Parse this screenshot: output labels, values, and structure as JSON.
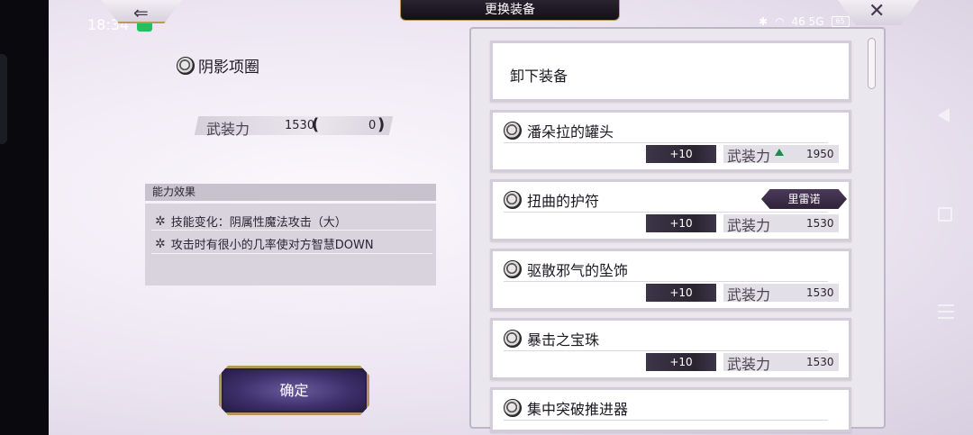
{
  "status_bar": {
    "time": "18:34",
    "network": "46 5G",
    "battery": "65"
  },
  "header": {
    "title": "更换装备",
    "back_icon": "back-arrow-icon",
    "close_icon": "close-icon"
  },
  "selected_item": {
    "name": "阴影项圈",
    "power_label": "武装力",
    "power_value": "1530",
    "power_diff": "0",
    "ability_header": "能力效果",
    "abilities": [
      "技能变化：阴属性魔法攻击（大）",
      "攻击时有很小的几率使对方智慧DOWN"
    ]
  },
  "confirm_label": "确定",
  "equip_list": {
    "unequip_label": "卸下装备",
    "items": [
      {
        "name": "潘朵拉的罐头",
        "plus": "+10",
        "stat_label": "武装力",
        "stat_value": "1950",
        "stat_up": true,
        "owner": ""
      },
      {
        "name": "扭曲的护符",
        "plus": "+10",
        "stat_label": "武装力",
        "stat_value": "1530",
        "stat_up": false,
        "owner": "里雷诺"
      },
      {
        "name": "驱散邪气的坠饰",
        "plus": "+10",
        "stat_label": "武装力",
        "stat_value": "1530",
        "stat_up": false,
        "owner": ""
      },
      {
        "name": "暴击之宝珠",
        "plus": "+10",
        "stat_label": "武装力",
        "stat_value": "1530",
        "stat_up": false,
        "owner": ""
      },
      {
        "name": "集中突破推进器",
        "plus": "",
        "stat_label": "",
        "stat_value": "",
        "stat_up": false,
        "owner": ""
      }
    ]
  },
  "colors": {
    "accent_gold": "#b59858",
    "button_purple": "#3d2f6a",
    "stat_up_green": "#1f8a4e"
  }
}
